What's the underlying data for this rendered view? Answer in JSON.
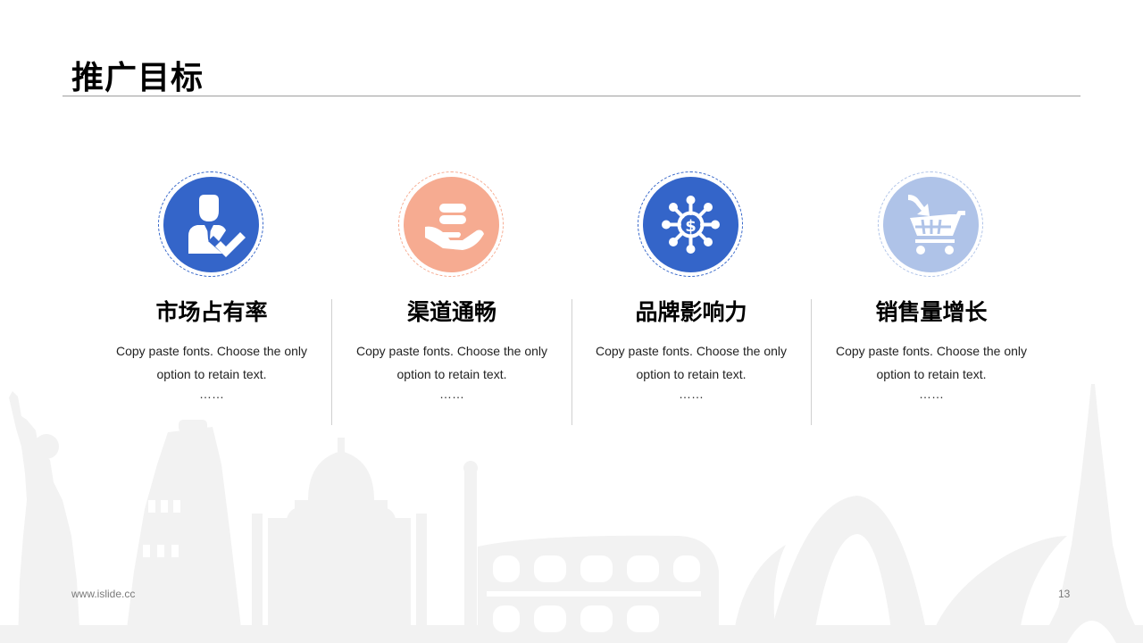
{
  "slide": {
    "title": "推广目标",
    "footer_url": "www.islide.cc",
    "page_number": "13"
  },
  "colors": {
    "blue": "#3465c9",
    "salmon": "#f6ab91",
    "light_blue": "#afc3e8",
    "skyline_gray": "#f2f2f2",
    "rule_gray": "#9e9e9e"
  },
  "columns": [
    {
      "icon": "user-check-icon",
      "color": "#3465c9",
      "title": "市场占有率",
      "desc": "Copy paste fonts. Choose the only option to retain text.",
      "dots": "……"
    },
    {
      "icon": "hand-coins-icon",
      "color": "#f6ab91",
      "title": "渠道通畅",
      "desc": "Copy paste fonts. Choose the only option to retain text.",
      "dots": "……"
    },
    {
      "icon": "dollar-network-icon",
      "color": "#3465c9",
      "title": "品牌影响力",
      "desc": "Copy paste fonts. Choose the only option to retain text.",
      "dots": "……"
    },
    {
      "icon": "shopping-cart-icon",
      "color": "#afc3e8",
      "title": "销售量增长",
      "desc": "Copy paste fonts. Choose the only option to retain text.",
      "dots": "……"
    }
  ]
}
